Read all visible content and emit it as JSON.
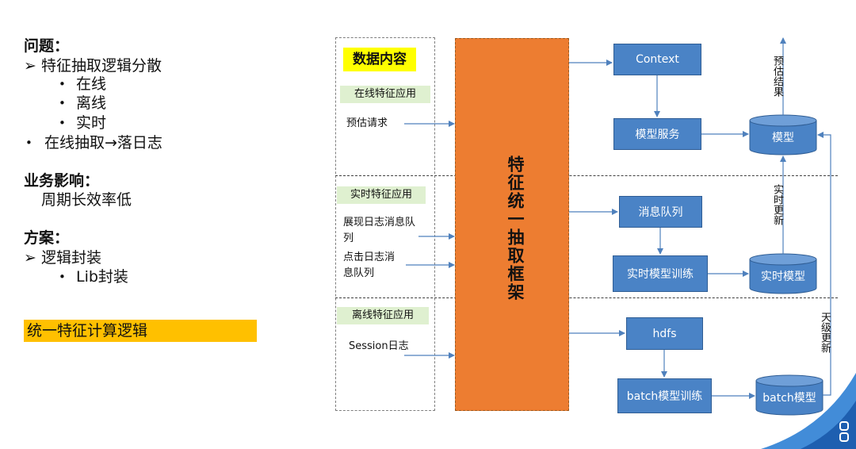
{
  "left_panel": {
    "problem_title": "问题：",
    "problem_item": "特征抽取逻辑分散",
    "sub_items": [
      "在线",
      "离线",
      "实时"
    ],
    "problem_item_2": "在线抽取→落日志",
    "impact_title": "业务影响：",
    "impact_text": "周期长效率低",
    "solution_title": "方案：",
    "solution_item": "逻辑封装",
    "solution_sub": "Lib封装",
    "highlight": "统一特征计算逻辑"
  },
  "diagram": {
    "data_content_label": "数据内容",
    "sections": [
      {
        "name": "在线特征应用",
        "sources": [
          "预估请求"
        ]
      },
      {
        "name": "实时特征应用",
        "sources": [
          "展现日志消息队列",
          "点击日志消息队列"
        ]
      },
      {
        "name": "离线特征应用",
        "sources": [
          "Session日志"
        ]
      }
    ],
    "framework_label": "特征统一抽取框架",
    "nodes": {
      "context": "Context",
      "model_service": "模型服务",
      "model": "模型",
      "message_queue": "消息队列",
      "realtime_training": "实时模型训练",
      "realtime_model": "实时模型",
      "hdfs": "hdfs",
      "batch_training": "batch模型训练",
      "batch_model": "batch模型"
    },
    "edge_labels": {
      "prediction_result": "预估结果",
      "realtime_update": "实时更新",
      "daily_update": "天级更新"
    }
  }
}
